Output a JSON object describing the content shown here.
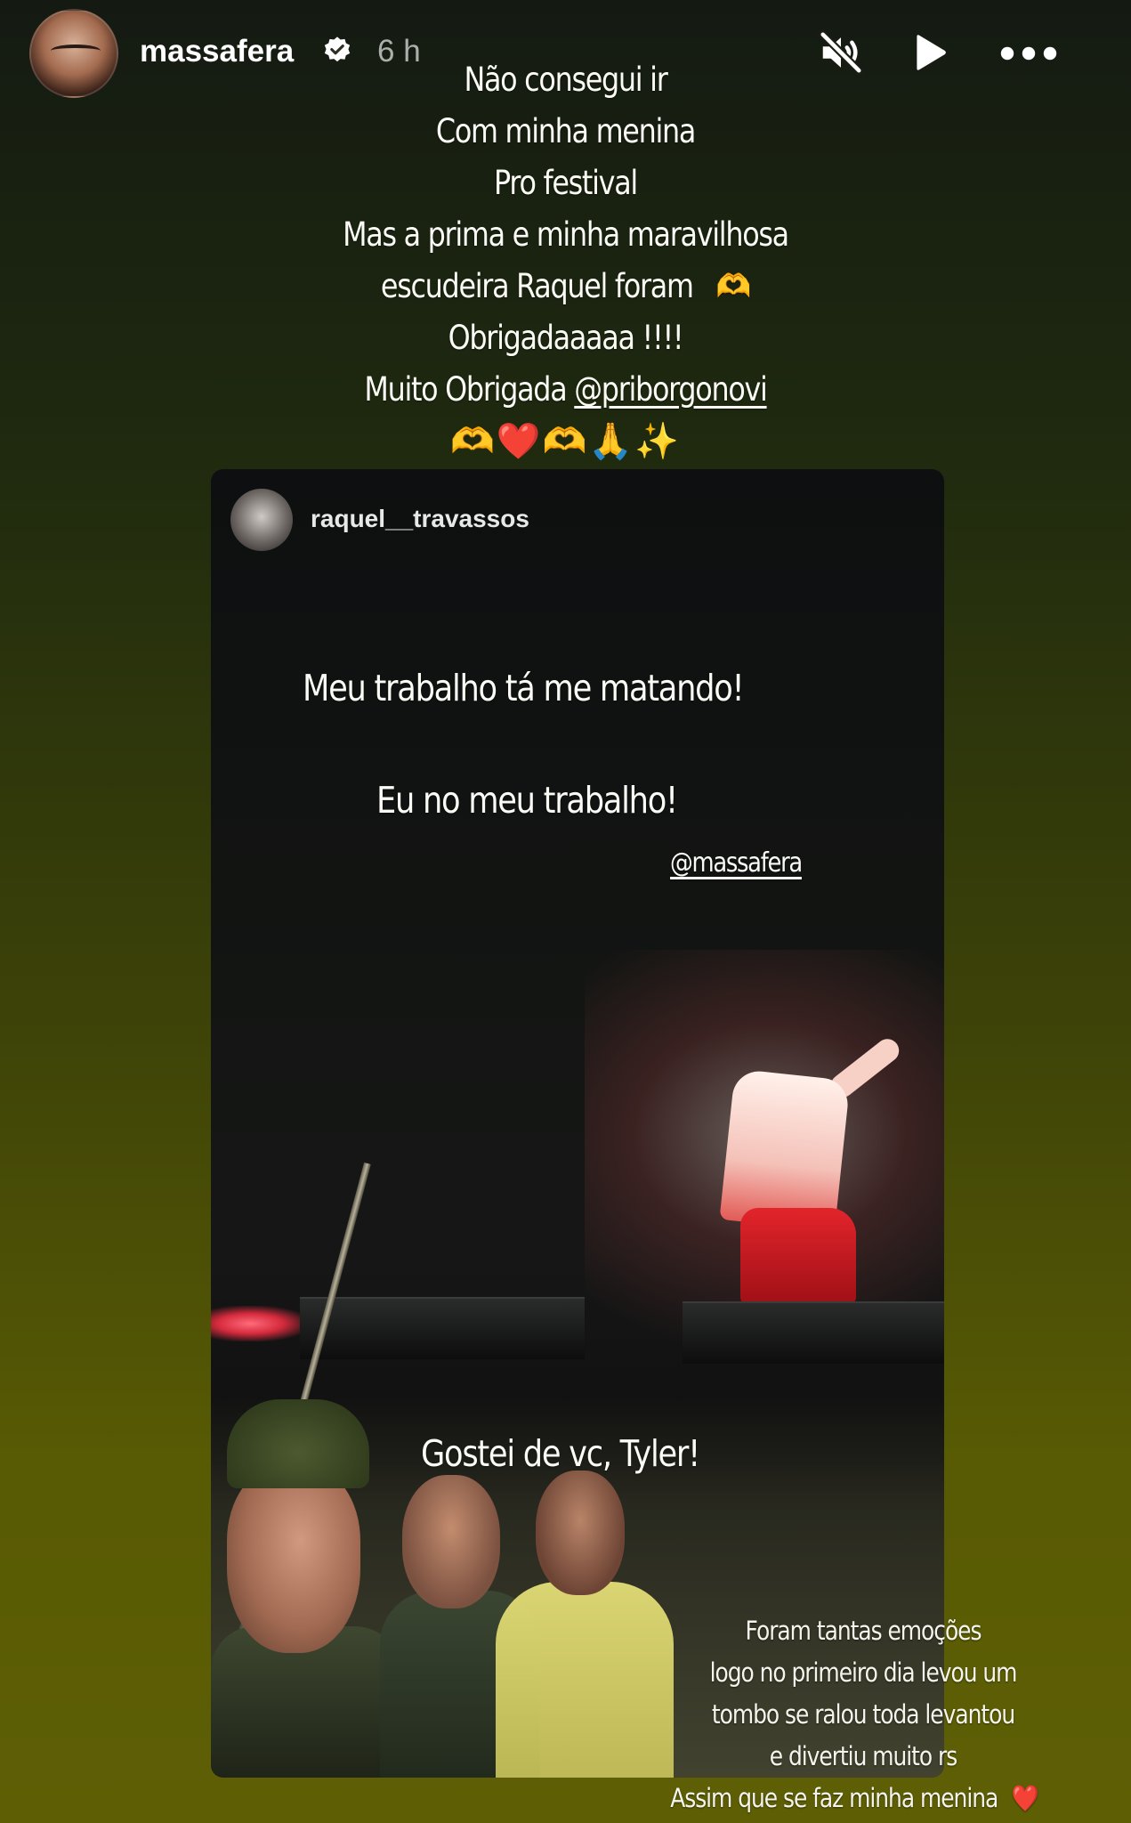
{
  "header": {
    "username": "massafera",
    "timestamp": "6 h",
    "avatar_icon": "profile-avatar",
    "verified_icon": "verified-badge-icon",
    "controls": [
      "mute-icon",
      "play-icon",
      "more-icon"
    ]
  },
  "caption": {
    "lines": [
      "Não consegui ir",
      "Com minha menina",
      "Pro festival",
      "Mas a prima e minha maravilhosa",
      "escudeira Raquel foram"
    ],
    "line5_emoji": "🫶",
    "line6": "Obrigadaaaaa !!!!",
    "line7_prefix": "Muito Obrigada ",
    "line7_mention": "@priborgonovi",
    "emoji_row": "🫶❤️🫶🙏✨"
  },
  "reshared_story": {
    "username": "raquel__travassos",
    "text_top": "Meu trabalho tá me matando!",
    "text_mid": "Eu no meu trabalho!",
    "mention": "@massafera",
    "text_crowd": "Gostei de vc, Tyler!",
    "bottom_lines": [
      "Foram tantas emoções",
      "logo no primeiro dia levou um",
      "tombo se ralou toda levantou",
      "e divertiu muito rs"
    ],
    "last_line": "Assim que se faz minha menina",
    "last_line_emoji": "❤️"
  },
  "colors": {
    "background_top": "#141a12",
    "background_bottom": "#5e5f05",
    "text": "#fbfbf5"
  }
}
